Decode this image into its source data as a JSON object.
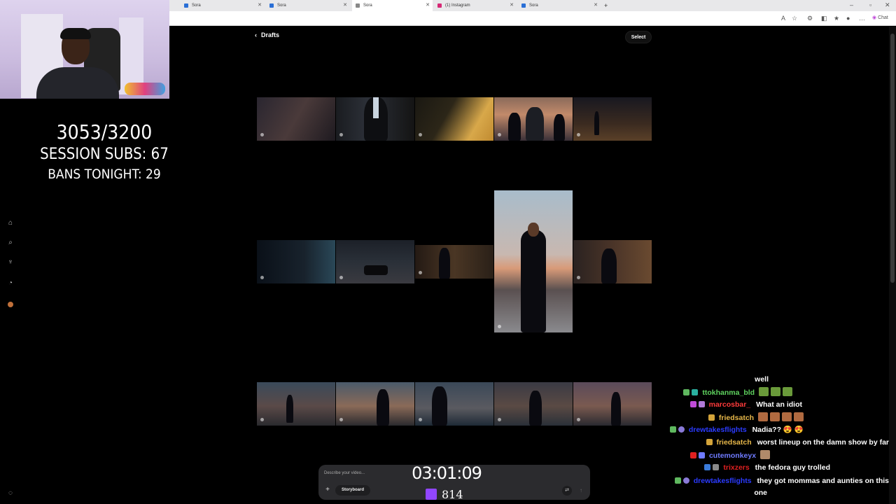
{
  "browser": {
    "tabs": [
      {
        "title": "Sora"
      },
      {
        "title": "Sora"
      },
      {
        "title": "Sora"
      },
      {
        "title": "(1) Instagram"
      },
      {
        "title": "Sora"
      }
    ],
    "new_tab_label": "+",
    "toolbar": {
      "chat_label": "Chat"
    }
  },
  "stream": {
    "sub_goal": "3053/3200",
    "session_subs": "SESSION SUBS: 67",
    "bans_tonight": "BANS TONIGHT: 29",
    "timer": "03:01:09",
    "viewers": "814"
  },
  "sora": {
    "back_label": "Drafts",
    "select_label": "Select",
    "sidebar_icons": [
      "home-icon",
      "search-icon",
      "trophy-icon",
      "bell-icon",
      "avatar-icon"
    ],
    "composer": {
      "placeholder": "Describe your video...",
      "storyboard_label": "Storyboard"
    }
  },
  "chat": {
    "messages": [
      {
        "user": "",
        "text": "well",
        "color": "#ffffff"
      },
      {
        "user": "ttokhanma_bld",
        "text": "",
        "color": "#5fd35f",
        "emotes": 3
      },
      {
        "user": "marcosbar_",
        "text": "What an idiot",
        "color": "#ff3b3b"
      },
      {
        "user": "friedsatch",
        "text": "",
        "color": "#e8b84a",
        "emotes": 4
      },
      {
        "user": "drewtakesflights",
        "text": "Nadia?? 😍 😍",
        "color": "#2b3bff"
      },
      {
        "user": "friedsatch",
        "text": "worst lineup on the damn show by far",
        "color": "#e8b84a"
      },
      {
        "user": "cutemonkeyx",
        "text": "",
        "color": "#6f7bff",
        "emotes": 1
      },
      {
        "user": "trixzers",
        "text": "the fedora guy trolled",
        "color": "#e02020"
      },
      {
        "user": "drewtakesflights",
        "text": "they got mommas and aunties on this",
        "color": "#2b3bff"
      },
      {
        "user": "",
        "text": "one",
        "color": "#ffffff"
      }
    ]
  }
}
